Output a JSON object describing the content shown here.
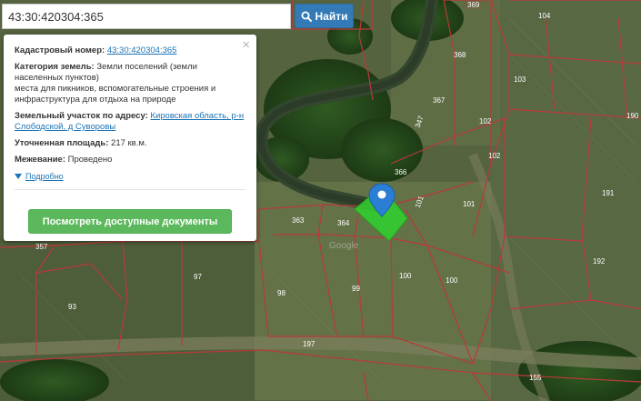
{
  "search": {
    "value": "43:30:420304:365",
    "button_label": "Найти"
  },
  "popup": {
    "cadastral_label": "Кадастровый номер:",
    "cadastral_value": "43:30:420304:365",
    "category_label": "Категория земель:",
    "category_value_1": "Земли поселений (земли",
    "category_value_2": "населенных пунктов)",
    "category_value_3": "места для пикников, вспомогательные строения и",
    "category_value_4": "инфраструктура для отдыха на природе",
    "address_label": "Земельный участок по адресу:",
    "address_value_1": "Кировская область, р-н",
    "address_value_2": "Слободской, д Суворовы",
    "area_label": "Уточненная площадь:",
    "area_value": "217 кв.м.",
    "survey_label": "Межевание:",
    "survey_value": "Проведено",
    "more_link": "Подробно",
    "docs_button": "Посмотреть доступные документы"
  },
  "map": {
    "parcel_labels": [
      "369",
      "104",
      "368",
      "103",
      "367",
      "102",
      "347",
      "366",
      "102",
      "190",
      "101",
      "101",
      "191",
      "363",
      "364",
      "357",
      "192",
      "97",
      "100",
      "100",
      "93",
      "98",
      "99",
      "197",
      "155"
    ],
    "watermark": "Google",
    "colors": {
      "parcel_border": "#b83a3a",
      "selected_parcel": "#2fd22f",
      "marker": "#2a7fd4"
    }
  }
}
